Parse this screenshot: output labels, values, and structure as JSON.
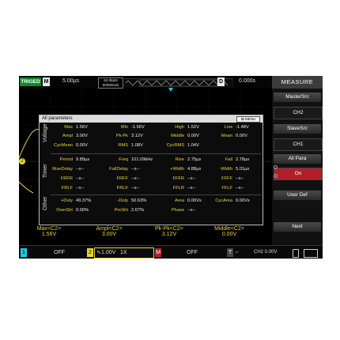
{
  "header": {
    "trig_status": "TRIGED",
    "mode_badge": "M",
    "timebase": "5.00µs",
    "sample_line1": "64.0kpts",
    "sample_line2": "500MSa/s",
    "delay_badge": "D",
    "delay_value": "0.000s"
  },
  "menu": {
    "title": "MEASURE",
    "items": [
      {
        "label": "MasterSrc",
        "value": "CH2"
      },
      {
        "label": "SlaveSrc",
        "value": "CH1"
      },
      {
        "label": "All Para",
        "value": "On"
      },
      {
        "label": "User Def"
      },
      {
        "label": "Next"
      }
    ]
  },
  "table": {
    "title": "All parameters",
    "menu_button": "MENU",
    "groups": {
      "voltage": "Voltage",
      "timer": "Timer",
      "other": "Other"
    },
    "rows": [
      [
        [
          "Max",
          "1.56V"
        ],
        [
          "Min",
          "-1.56V"
        ],
        [
          "High",
          "1.52V"
        ],
        [
          "Low",
          "-1.48V"
        ]
      ],
      [
        [
          "Ampl",
          "3.00V"
        ],
        [
          "Pk-Pk",
          "3.12V"
        ],
        [
          "Middle",
          "0.00V"
        ],
        [
          "Mean",
          "0.00V"
        ]
      ],
      [
        [
          "CycMean",
          "0.00V"
        ],
        [
          "RMS",
          "1.08V"
        ],
        [
          "CycRMS",
          "1.04V"
        ],
        [
          "",
          ""
        ]
      ],
      [
        [
          "Period",
          "9.89µs"
        ],
        [
          "Freq",
          "101.09kHz"
        ],
        [
          "Rise",
          "2.75µs"
        ],
        [
          "Fall",
          "2.78µs"
        ]
      ],
      [
        [
          "RiseDelay",
          "--x--"
        ],
        [
          "FallDelay",
          "--x--"
        ],
        [
          "+Width",
          "4.88µs"
        ],
        [
          "-Width",
          "5.01µs"
        ]
      ],
      [
        [
          "FRFR",
          "--x--"
        ],
        [
          "FRFF",
          "--x--"
        ],
        [
          "FFFR",
          "--x--"
        ],
        [
          "FFFF",
          "--x--"
        ]
      ],
      [
        [
          "FRLF",
          "--x--"
        ],
        [
          "FRLF",
          "--x--"
        ],
        [
          "FFLR",
          "--x--"
        ],
        [
          "FFLF",
          "--x--"
        ]
      ],
      [
        [
          "+Duty",
          "49.37%"
        ],
        [
          "-Duty",
          "50.63%"
        ],
        [
          "Area",
          "0.00Vs"
        ],
        [
          "CycArea",
          "0.00Vs"
        ]
      ],
      [
        [
          "OverSht",
          "0.00%"
        ],
        [
          "PreSht",
          "2.67%"
        ],
        [
          "Phase",
          "--x--"
        ],
        [
          "",
          ""
        ]
      ]
    ]
  },
  "measurements": [
    {
      "label": "Max<C2>",
      "value": "1.56V"
    },
    {
      "label": "Ampl<C2>",
      "value": "3.00V"
    },
    {
      "label": "Pk-Pk<C2>",
      "value": "3.12V"
    },
    {
      "label": "Middle<C2>",
      "value": "0.00V"
    }
  ],
  "bottom": {
    "ch1_num": "1",
    "ch1_state": "OFF",
    "ch2_num": "2",
    "ch2_scale": "1.00V",
    "ch2_probe": "1X",
    "math_badge": "M",
    "math_state": "OFF",
    "trig_badge": "T",
    "trig_level": "CH2 0.00V"
  },
  "colors": {
    "ch2_yellow": "#e8d43a",
    "trig_green": "#0c8a2a",
    "menu_red": "#b0202a",
    "ch1_cyan": "#1ec8e6"
  },
  "icons": {
    "usb": "usb-icon",
    "battery": "battery-icon"
  }
}
